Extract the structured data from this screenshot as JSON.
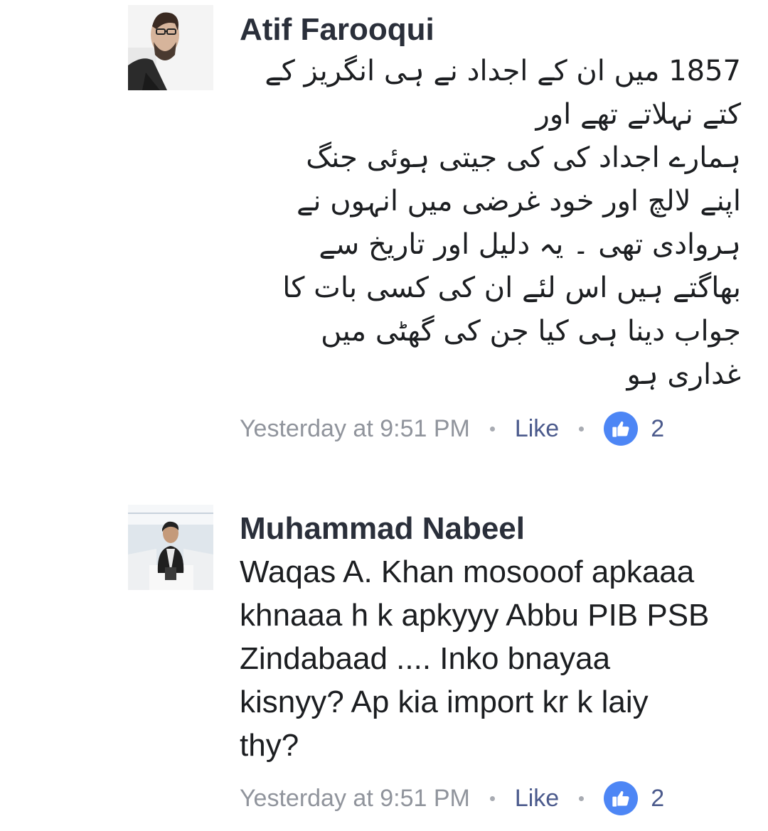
{
  "comments": [
    {
      "author": "Atif Farooqui",
      "avatar_icon": "profile-photo",
      "body_lines": [
        "1857 میں ان کے اجداد نے ہی انگریز کے",
        "کتے نہلاتے تھے اور",
        "ہمارے اجداد کی کی جیتی ہوئی جنگ",
        "اپنے لالچ اور خود غرضی میں انہوں نے",
        "ہروادی تھی ۔ یہ دلیل اور تاریخ سے",
        "بھاگتے ہیں اس لئے ان کی کسی بات کا",
        "جواب دینا ہی کیا جن کی گھٹی میں",
        "غداری ہو"
      ],
      "timestamp": "Yesterday at 9:51 PM",
      "like_label": "Like",
      "reaction_icon": "thumbs-up-icon",
      "reaction_count": "2"
    },
    {
      "author": "Muhammad Nabeel",
      "avatar_icon": "profile-photo",
      "body_lines": [
        "Waqas A. Khan mosooof apkaaa",
        "khnaaa h k apkyyy Abbu PIB PSB",
        "Zindabaad .... Inko bnayaa",
        "kisnyy? Ap kia import kr k laiy",
        "thy?"
      ],
      "timestamp": "Yesterday at 9:51 PM",
      "like_label": "Like",
      "reaction_icon": "thumbs-up-icon",
      "reaction_count": "2"
    }
  ],
  "colors": {
    "author": "#2a2f3a",
    "meta_gray": "#90949c",
    "link_blue": "#4b5a8c",
    "like_badge": "#4d86f5"
  }
}
